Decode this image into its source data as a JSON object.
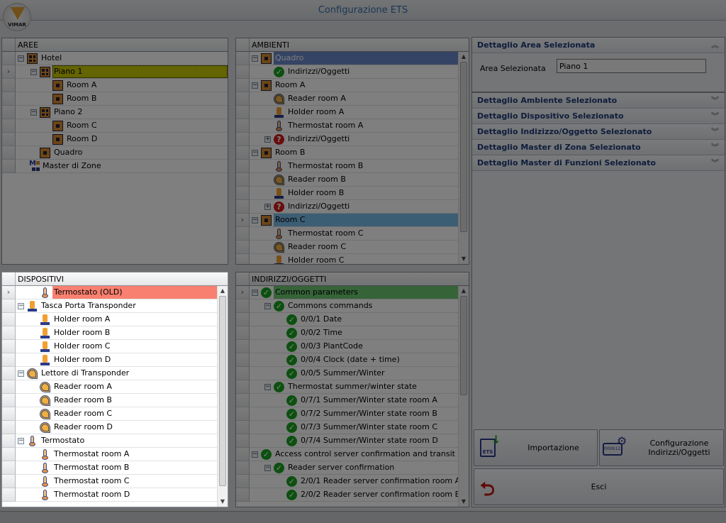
{
  "window": {
    "title": "Configurazione ETS",
    "logo_text": "VIMAR"
  },
  "aree": {
    "header": "AREE",
    "rows": [
      {
        "label": "Hotel",
        "level": 0,
        "icon": "area",
        "expander": "-"
      },
      {
        "label": "Piano 1",
        "level": 1,
        "icon": "area",
        "expander": "-",
        "selected": "yellow",
        "current": true
      },
      {
        "label": "Room A",
        "level": 2,
        "icon": "room"
      },
      {
        "label": "Room B",
        "level": 2,
        "icon": "room"
      },
      {
        "label": "Piano 2",
        "level": 1,
        "icon": "area",
        "expander": "-"
      },
      {
        "label": "Room C",
        "level": 2,
        "icon": "room"
      },
      {
        "label": "Room D",
        "level": 2,
        "icon": "room"
      },
      {
        "label": "Quadro",
        "level": 1,
        "icon": "room"
      },
      {
        "label": "Master di Zone",
        "level": 0,
        "icon": "master",
        "noexp": true
      }
    ]
  },
  "ambienti": {
    "header": "AMBIENTI",
    "rows": [
      {
        "label": "Quadro",
        "level": 0,
        "icon": "room",
        "expander": "-",
        "selected": "blue"
      },
      {
        "label": "Indirizzi/Oggetti",
        "level": 1,
        "icon": "check"
      },
      {
        "label": "Room A",
        "level": 0,
        "icon": "room",
        "expander": "-"
      },
      {
        "label": "Reader room A",
        "level": 1,
        "icon": "reader"
      },
      {
        "label": "Holder room A",
        "level": 1,
        "icon": "holder"
      },
      {
        "label": "Thermostat room A",
        "level": 1,
        "icon": "thermo"
      },
      {
        "label": "Indirizzi/Oggetti",
        "level": 1,
        "icon": "question",
        "expander": "+"
      },
      {
        "label": "Room B",
        "level": 0,
        "icon": "room",
        "expander": "-"
      },
      {
        "label": "Thermostat room B",
        "level": 1,
        "icon": "thermo"
      },
      {
        "label": "Reader room B",
        "level": 1,
        "icon": "reader"
      },
      {
        "label": "Holder room B",
        "level": 1,
        "icon": "holder"
      },
      {
        "label": "Indirizzi/Oggetti",
        "level": 1,
        "icon": "question",
        "expander": "+"
      },
      {
        "label": "Room C",
        "level": 0,
        "icon": "room",
        "expander": "-",
        "selected": "lblue",
        "current": true
      },
      {
        "label": "Thermostat room C",
        "level": 1,
        "icon": "thermo"
      },
      {
        "label": "Reader room C",
        "level": 1,
        "icon": "reader"
      },
      {
        "label": "Holder room C",
        "level": 1,
        "icon": "holder"
      }
    ]
  },
  "dispositivi": {
    "header": "DISPOSITIVI",
    "rows": [
      {
        "label": "Termostato (OLD)",
        "level": 1,
        "icon": "thermo",
        "selected": "red",
        "current": true
      },
      {
        "label": "Tasca Porta Transponder",
        "level": 0,
        "icon": "holder",
        "expander": "-"
      },
      {
        "label": "Holder room A",
        "level": 1,
        "icon": "holder"
      },
      {
        "label": "Holder room B",
        "level": 1,
        "icon": "holder"
      },
      {
        "label": "Holder room C",
        "level": 1,
        "icon": "holder"
      },
      {
        "label": "Holder room D",
        "level": 1,
        "icon": "holder"
      },
      {
        "label": "Lettore di Transponder",
        "level": 0,
        "icon": "reader",
        "expander": "-"
      },
      {
        "label": "Reader room A",
        "level": 1,
        "icon": "reader"
      },
      {
        "label": "Reader room B",
        "level": 1,
        "icon": "reader"
      },
      {
        "label": "Reader room C",
        "level": 1,
        "icon": "reader"
      },
      {
        "label": "Reader room D",
        "level": 1,
        "icon": "reader"
      },
      {
        "label": "Termostato",
        "level": 0,
        "icon": "thermo",
        "expander": "-"
      },
      {
        "label": "Thermostat room A",
        "level": 1,
        "icon": "thermo"
      },
      {
        "label": "Thermostat room B",
        "level": 1,
        "icon": "thermo"
      },
      {
        "label": "Thermostat room C",
        "level": 1,
        "icon": "thermo"
      },
      {
        "label": "Thermostat room D",
        "level": 1,
        "icon": "thermo"
      }
    ]
  },
  "indirizzi": {
    "header": "INDIRIZZI/OGGETTI",
    "rows": [
      {
        "label": "Common parameters",
        "level": 0,
        "icon": "check",
        "expander": "-",
        "selected": "green",
        "current": true
      },
      {
        "label": "Commons commands",
        "level": 1,
        "icon": "check",
        "expander": "-"
      },
      {
        "label": "0/0/1 Date",
        "level": 2,
        "icon": "check"
      },
      {
        "label": "0/0/2 Time",
        "level": 2,
        "icon": "check"
      },
      {
        "label": "0/0/3 PlantCode",
        "level": 2,
        "icon": "check"
      },
      {
        "label": "0/0/4 Clock (date + time)",
        "level": 2,
        "icon": "check"
      },
      {
        "label": "0/0/5 Summer/Winter",
        "level": 2,
        "icon": "check"
      },
      {
        "label": "Thermostat summer/winter state",
        "level": 1,
        "icon": "check",
        "expander": "-"
      },
      {
        "label": "0/7/1 Summer/Winter state room A",
        "level": 2,
        "icon": "check"
      },
      {
        "label": "0/7/2 Summer/Winter state room B",
        "level": 2,
        "icon": "check"
      },
      {
        "label": "0/7/3 Summer/Winter state room C",
        "level": 2,
        "icon": "check"
      },
      {
        "label": "0/7/4 Summer/Winter state room D",
        "level": 2,
        "icon": "check"
      },
      {
        "label": "Access control server confirmation and transit",
        "level": 0,
        "icon": "check",
        "expander": "-"
      },
      {
        "label": "Reader server confirmation",
        "level": 1,
        "icon": "check",
        "expander": "-"
      },
      {
        "label": "2/0/1 Reader server confirmation room A",
        "level": 2,
        "icon": "check"
      },
      {
        "label": "2/0/2 Reader server confirmation room B",
        "level": 2,
        "icon": "check"
      }
    ]
  },
  "details": {
    "sections": [
      {
        "title": "Dettaglio Area Selezionata",
        "expanded": true
      },
      {
        "title": "Dettaglio Ambiente Selezionato"
      },
      {
        "title": "Dettaglio Dispositivo Selezionato"
      },
      {
        "title": "Dettaglio Indizizzo/Oggetto Selezionato"
      },
      {
        "title": "Dettaglio Master di Zona Selezionato"
      },
      {
        "title": "Dettaglio Master di Funzioni Selezionato"
      }
    ],
    "area_label": "Area Selezionata",
    "area_value": "Piano 1"
  },
  "buttons": {
    "import": "Importazione",
    "import_icon_text": "ETS",
    "config_line1": "Configurazione",
    "config_line2": "Indirizzi/Oggetti",
    "config_icon_text": "000b123",
    "exit": "Esci"
  }
}
